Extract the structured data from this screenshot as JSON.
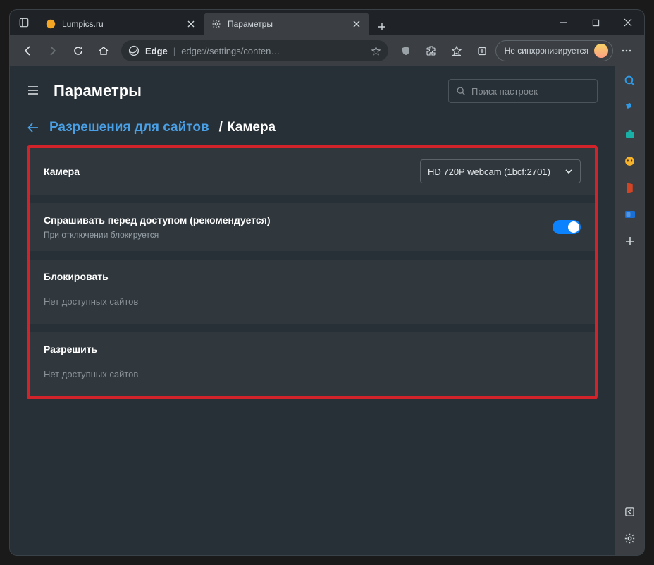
{
  "tabs": [
    {
      "title": "Lumpics.ru",
      "active": false
    },
    {
      "title": "Параметры",
      "active": true
    }
  ],
  "toolbar": {
    "brand": "Edge",
    "url": "edge://settings/conten…",
    "profile_label": "Не синхронизируется"
  },
  "settings": {
    "title": "Параметры",
    "search_placeholder": "Поиск настроек",
    "breadcrumb_link": "Разрешения для сайтов",
    "breadcrumb_sep": "/",
    "breadcrumb_current": "Камера",
    "camera_label": "Камера",
    "camera_selected": "HD 720P webcam (1bcf:2701)",
    "ask_label": "Спрашивать перед доступом (рекомендуется)",
    "ask_sub": "При отключении блокируется",
    "block_label": "Блокировать",
    "block_empty": "Нет доступных сайтов",
    "allow_label": "Разрешить",
    "allow_empty": "Нет доступных сайтов"
  }
}
